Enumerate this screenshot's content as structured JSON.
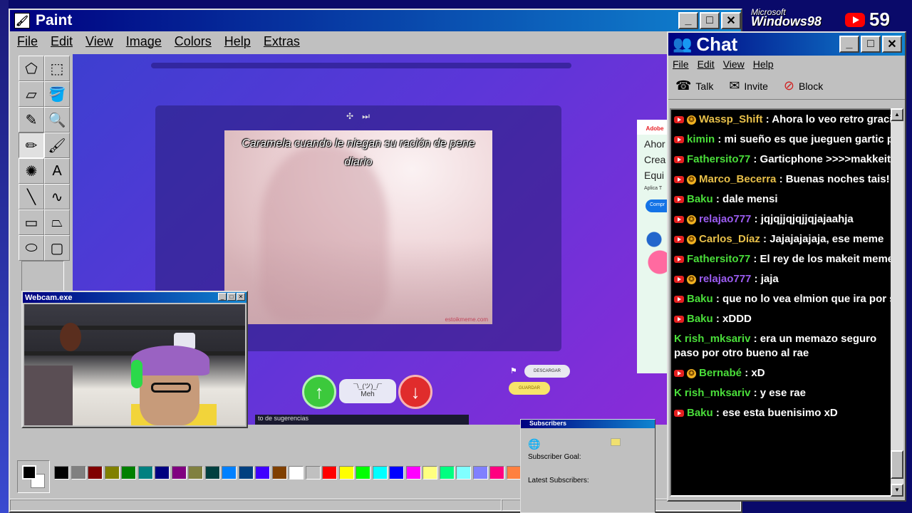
{
  "paint": {
    "title": "Paint",
    "menu": [
      "File",
      "Edit",
      "View",
      "Image",
      "Colors",
      "Help",
      "Extras"
    ],
    "tools": [
      {
        "name": "free-select-tool-icon",
        "glyph": "⬠"
      },
      {
        "name": "rect-select-tool-icon",
        "glyph": "⬚"
      },
      {
        "name": "eraser-tool-icon",
        "glyph": "▱"
      },
      {
        "name": "fill-tool-icon",
        "glyph": "🪣"
      },
      {
        "name": "color-picker-tool-icon",
        "glyph": "✎"
      },
      {
        "name": "magnifier-tool-icon",
        "glyph": "🔍"
      },
      {
        "name": "pencil-tool-icon",
        "glyph": "✏"
      },
      {
        "name": "brush-tool-icon",
        "glyph": "🖌"
      },
      {
        "name": "airbrush-tool-icon",
        "glyph": "✺"
      },
      {
        "name": "text-tool-icon",
        "glyph": "A"
      },
      {
        "name": "line-tool-icon",
        "glyph": "╲"
      },
      {
        "name": "curve-tool-icon",
        "glyph": "∿"
      },
      {
        "name": "rectangle-tool-icon",
        "glyph": "▭"
      },
      {
        "name": "polygon-tool-icon",
        "glyph": "⏢"
      },
      {
        "name": "ellipse-tool-icon",
        "glyph": "⬭"
      },
      {
        "name": "rounded-rect-tool-icon",
        "glyph": "▢"
      }
    ],
    "palette": [
      "#000000",
      "#808080",
      "#800000",
      "#808000",
      "#008000",
      "#008080",
      "#000080",
      "#800080",
      "#808040",
      "#004040",
      "#0080ff",
      "#004080",
      "#4000ff",
      "#804000",
      "#ffffff",
      "#c0c0c0",
      "#ff0000",
      "#ffff00",
      "#00ff00",
      "#00ffff",
      "#0000ff",
      "#ff00ff",
      "#ffff80",
      "#00ff80",
      "#80ffff",
      "#8080ff",
      "#ff0080",
      "#ff8040"
    ]
  },
  "meme": {
    "caption": "Caramela cuando le niegan su ración de pene diario",
    "watermark": "estoikmeme.com",
    "meh_face": "¯\\_(ツ)_/¯",
    "meh_label": "Meh",
    "download_label": "DESCARGAR",
    "save_label": "GUARDAR",
    "up_glyph": "↑",
    "down_glyph": "↓",
    "bottom_text": "to de sugerencias"
  },
  "ad": {
    "brand": "Adobe",
    "lines": [
      "Ahor",
      "Crea",
      "Equi"
    ],
    "small": "Aplica T",
    "button": "Compr"
  },
  "webcam": {
    "title": "Webcam.exe"
  },
  "chat": {
    "title": "Chat",
    "menu": [
      "File",
      "Edit",
      "View",
      "Help"
    ],
    "tools": [
      {
        "name": "talk",
        "label": "Talk",
        "icon": "☎"
      },
      {
        "name": "invite",
        "label": "Invite",
        "icon": "✉"
      },
      {
        "name": "block",
        "label": "Block",
        "icon": "⊘"
      }
    ],
    "messages": [
      {
        "platform": "yt",
        "badge": true,
        "user": "Wassp_Shift",
        "color": "#e8c04a",
        "text": "Ahora lo veo retro gracias"
      },
      {
        "platform": "yt",
        "badge": false,
        "user": "kimin",
        "color": "#4ade3a",
        "text": "mi sueño es que jueguen gartic phone"
      },
      {
        "platform": "yt",
        "badge": false,
        "user": "Fathersito77",
        "color": "#4ade3a",
        "text": "Garticphone >>>>makkeitmeme"
      },
      {
        "platform": "yt",
        "badge": true,
        "user": "Marco_Becerra",
        "color": "#e8c04a",
        "text": "Buenas noches tais! 😎"
      },
      {
        "platform": "yt",
        "badge": false,
        "user": "Baku",
        "color": "#4ade3a",
        "text": "dale mensi"
      },
      {
        "platform": "yt",
        "badge": true,
        "user": "relajao777",
        "color": "#9b5cf0",
        "text": "jqjqjjqjqjjqjajaahja"
      },
      {
        "platform": "yt",
        "badge": true,
        "user": "Carlos_Díaz",
        "color": "#e8c04a",
        "text": "Jajajajajaja, ese meme"
      },
      {
        "platform": "yt",
        "badge": false,
        "user": "Fathersito77",
        "color": "#4ade3a",
        "text": "El rey de los makeit meme"
      },
      {
        "platform": "yt",
        "badge": true,
        "user": "relajao777",
        "color": "#9b5cf0",
        "text": "jaja"
      },
      {
        "platform": "yt",
        "badge": false,
        "user": "Baku",
        "color": "#4ade3a",
        "text": "que no lo vea elmion que ira por spy"
      },
      {
        "platform": "yt",
        "badge": false,
        "user": "Baku",
        "color": "#4ade3a",
        "text": "xDDD"
      },
      {
        "platform": "kick",
        "badge": false,
        "user": "rish_mksariv",
        "color": "#4ade3a",
        "text": "era un memazo seguro paso por otro bueno al rae"
      },
      {
        "platform": "yt",
        "badge": true,
        "user": "Bernabé",
        "color": "#4ade3a",
        "text": "xD"
      },
      {
        "platform": "kick",
        "badge": false,
        "user": "rish_mksariv",
        "color": "#4ade3a",
        "text": "y ese rae"
      },
      {
        "platform": "yt",
        "badge": false,
        "user": "Baku",
        "color": "#4ade3a",
        "text": "ese esta buenisimo xD"
      }
    ]
  },
  "subscribers": {
    "title": "Subscribers",
    "goal_label": "Subscriber Goal:",
    "latest_label": "Latest Subscribers:"
  },
  "overlay": {
    "microsoft": "Microsoft",
    "windows98": "Windows98",
    "viewer_count": "59"
  }
}
